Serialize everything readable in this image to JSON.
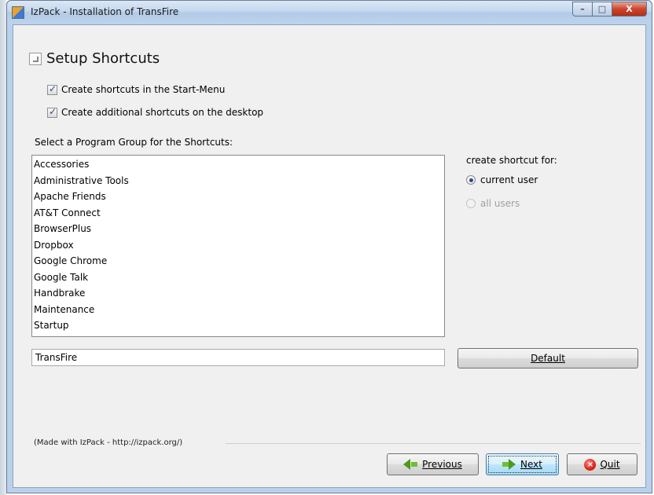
{
  "window": {
    "title": "IzPack - Installation of TransFire",
    "minimize_glyph": "–",
    "maximize_glyph": "□",
    "close_glyph": "X"
  },
  "panel": {
    "title": "Setup Shortcuts"
  },
  "options": {
    "start_menu_label": "Create shortcuts in the Start-Menu",
    "start_menu_checked": true,
    "desktop_label": "Create additional shortcuts on the desktop",
    "desktop_checked": true
  },
  "program_group": {
    "heading": "Select a Program Group for the Shortcuts:",
    "items": [
      "Accessories",
      "Administrative Tools",
      "Apache Friends",
      "AT&T Connect",
      "BrowserPlus",
      "Dropbox",
      "Google Chrome",
      "Google Talk",
      "Handbrake",
      "Maintenance",
      "Startup"
    ],
    "value": "TransFire",
    "default_button": "Default"
  },
  "shortcut_for": {
    "label": "create shortcut for:",
    "current_user": "current user",
    "all_users": "all users",
    "selected": "current user"
  },
  "footer": {
    "made_with": "(Made with IzPack - http://izpack.org/)",
    "previous": "Previous",
    "next": "Next",
    "quit": "Quit",
    "quit_glyph": "×"
  },
  "colors": {
    "accent": "#3c7fb1",
    "client_bg": "#f0f0f0",
    "titlebar": "#c3d7ee"
  }
}
